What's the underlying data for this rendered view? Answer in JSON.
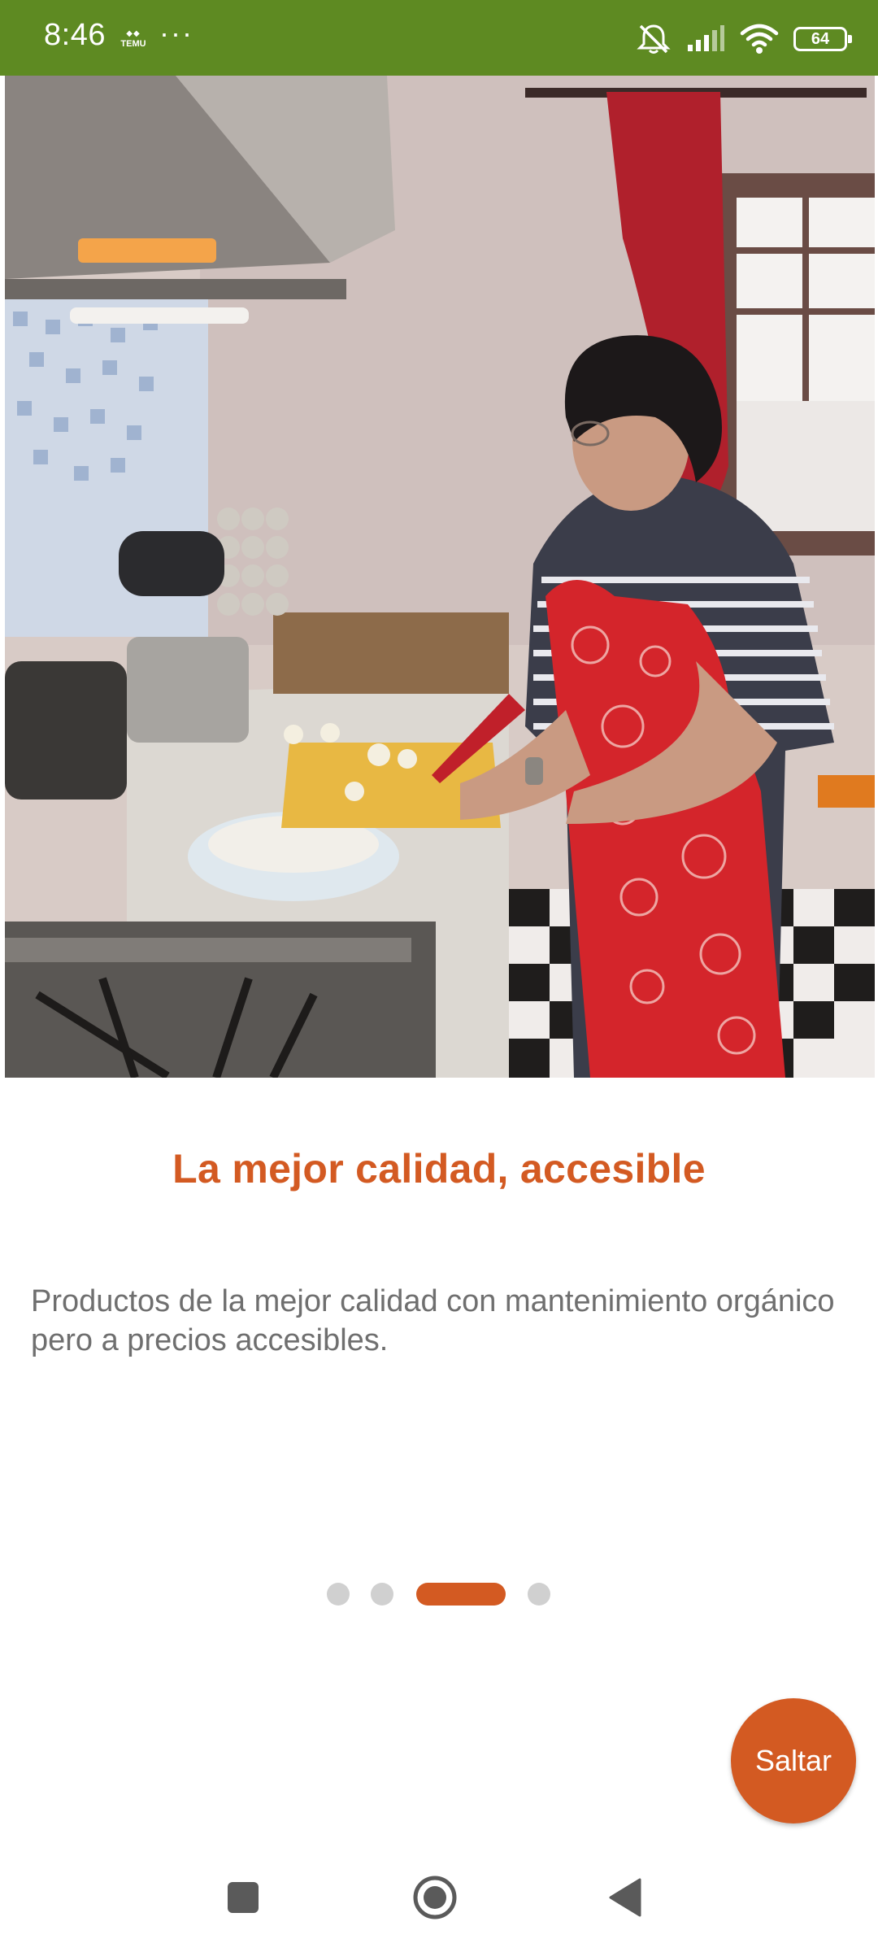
{
  "status_bar": {
    "time": "8:46",
    "app_icon_label": "TEMU",
    "more_label": "···",
    "battery_level": "64",
    "icons": [
      "mute-icon",
      "signal-icon",
      "wifi-icon",
      "battery-icon"
    ]
  },
  "hero": {
    "image_subject": "woman-cooking-in-kitchen"
  },
  "slide": {
    "title": "La mejor calidad, accesible",
    "description": "Productos de la mejor calidad con mantenimiento orgánico pero a precios accesibles."
  },
  "pager": {
    "total": 4,
    "active_index": 2
  },
  "skip_button": {
    "label": "Saltar"
  },
  "nav_bar": {
    "icons": [
      "recent-apps-icon",
      "home-icon",
      "back-icon"
    ]
  },
  "colors": {
    "status_bar": "#5e8a22",
    "accent": "#d35a22",
    "description_text": "#6f6f6f",
    "dot_inactive": "#d0d0d0"
  }
}
